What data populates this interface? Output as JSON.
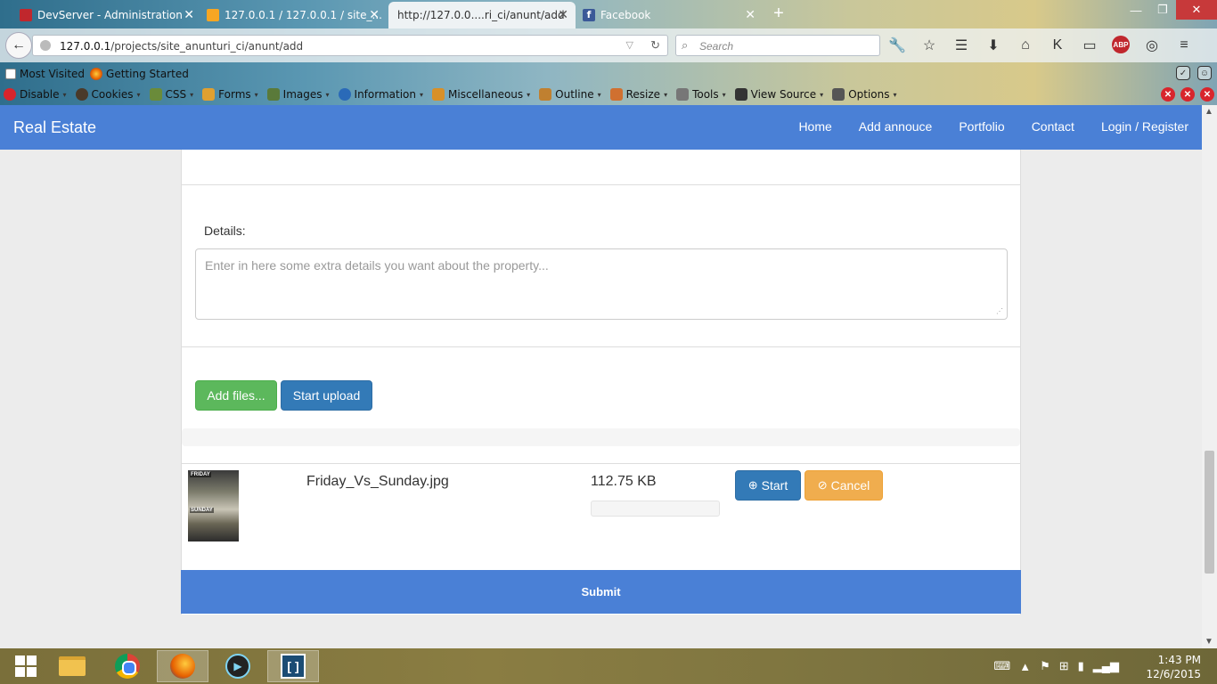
{
  "browser": {
    "tabs": [
      {
        "label": "DevServer - Administration",
        "favicon_color": "#c0272d"
      },
      {
        "label": "127.0.0.1 / 127.0.0.1 / site_...",
        "favicon_color": "#f6a623"
      },
      {
        "label": "http://127.0.0....ri_ci/anunt/add",
        "favicon_color": "#dddddd"
      },
      {
        "label": "Facebook",
        "favicon_color": "#3b5998"
      }
    ],
    "url_host": "127.0.0.1",
    "url_path": "/projects/site_anunturi_ci/anunt/add",
    "search_placeholder": "Search",
    "bookmarks": [
      "Most Visited",
      "Getting Started"
    ],
    "devtools": [
      "Disable",
      "Cookies",
      "CSS",
      "Forms",
      "Images",
      "Information",
      "Miscellaneous",
      "Outline",
      "Resize",
      "Tools",
      "View Source",
      "Options"
    ],
    "abp_label": "ABP"
  },
  "site": {
    "brand": "Real Estate",
    "nav": [
      "Home",
      "Add annouce",
      "Portfolio",
      "Contact",
      "Login / Register"
    ],
    "accent": "#4a80d6"
  },
  "form": {
    "details_label": "Details:",
    "details_placeholder": "Enter in here some extra details you want about the property...",
    "add_files": "Add files...",
    "start_upload": "Start upload",
    "submit": "Submit"
  },
  "upload": {
    "file_name": "Friday_Vs_Sunday.jpg",
    "file_size": "112.75 KB",
    "progress": 0,
    "start_label": "Start",
    "cancel_label": "Cancel",
    "thumb_text_top": "FRIDAY",
    "thumb_text_mid": "SUNDAY"
  },
  "taskbar": {
    "time": "1:43 PM",
    "date": "12/6/2015"
  }
}
